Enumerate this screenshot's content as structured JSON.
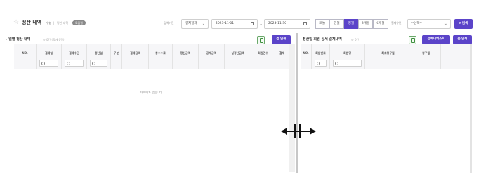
{
  "header": {
    "title": "정산 내역",
    "breadcrumb": {
      "home": "수납",
      "sep": "|",
      "mid": "정산 내역",
      "pill": "도움말"
    },
    "period_label": "검색기간",
    "period_select": "결제일자",
    "date_from": "2023-11-01",
    "date_to": "2023-11-30",
    "tilde": "~",
    "quick_ranges": [
      "오늘",
      "전월",
      "당월",
      "3개월",
      "6개월"
    ],
    "active_range": "당월",
    "method_label": "결제수단",
    "method_select": "--선택--",
    "search_button": "검색"
  },
  "left_panel": {
    "title": "일별 정산 내역",
    "count_text": "총 0건 (합계 0건)",
    "excel_icon": "excel-icon",
    "print_button": "인쇄",
    "columns": [
      "NO.",
      "결제일",
      "결제수단",
      "정산일",
      "구분",
      "결제금액",
      "총수수료",
      "정산금액",
      "공제금액",
      "실정산금액",
      "회원건수",
      "결제"
    ],
    "empty_message": "데이터가 없습니다."
  },
  "right_panel": {
    "title": "정산일 회원 상세 결제내역",
    "count_text": "총 0건",
    "excel_icon": "excel-icon",
    "all_view_button": "전체내역조회",
    "print_button": "인쇄",
    "columns": [
      "NO.",
      "회원번호",
      "회원명",
      "최초청구월",
      "청구월"
    ]
  },
  "colors": {
    "accent": "#5b44c9",
    "excel": "#3f8f3f"
  }
}
